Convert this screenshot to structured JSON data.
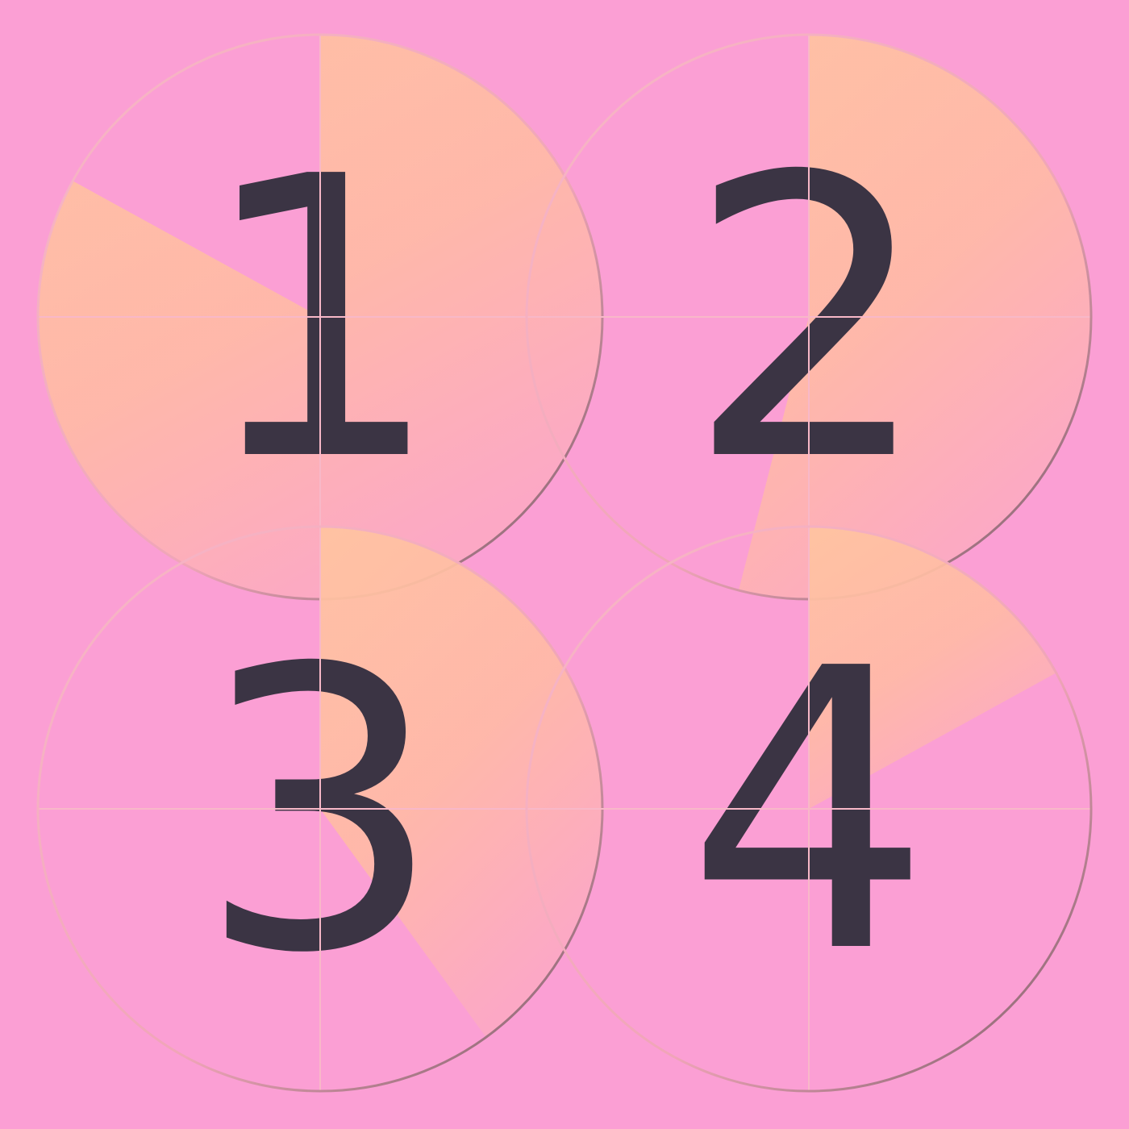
{
  "colors": {
    "background": "#fb9fd4",
    "wedge_light": "#ffc4a0",
    "wedge_fade": "#fca9c4",
    "numeral": "#3b3444",
    "line": "#f8b8c8",
    "edge": "#8d6d72"
  },
  "tiles": [
    {
      "label": "1",
      "sweep_fraction": 0.83
    },
    {
      "label": "2",
      "sweep_fraction": 0.54
    },
    {
      "label": "3",
      "sweep_fraction": 0.4
    },
    {
      "label": "4",
      "sweep_fraction": 0.17
    }
  ]
}
